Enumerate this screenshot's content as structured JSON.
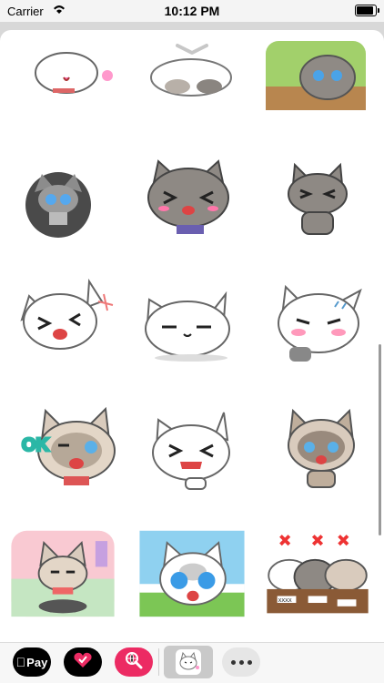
{
  "status_bar": {
    "carrier": "Carrier",
    "time": "10:12 PM"
  },
  "sheet": {
    "grid": {
      "stickers": [
        {
          "name": "sticker-1",
          "desc": "white cat running with heart"
        },
        {
          "name": "sticker-2",
          "desc": "cats playing together"
        },
        {
          "name": "sticker-3",
          "desc": "gray cat on brick wall"
        },
        {
          "name": "sticker-4",
          "desc": "cat on robot vacuum gray"
        },
        {
          "name": "sticker-5",
          "desc": "gray cat laughing"
        },
        {
          "name": "sticker-6",
          "desc": "gray cat excited"
        },
        {
          "name": "sticker-7",
          "desc": "white cat laughing"
        },
        {
          "name": "sticker-8",
          "desc": "white cat lying down"
        },
        {
          "name": "sticker-9",
          "desc": "white cat blushing"
        },
        {
          "name": "sticker-10",
          "desc": "siamese cat OK sign"
        },
        {
          "name": "sticker-11",
          "desc": "white cat giggling"
        },
        {
          "name": "sticker-12",
          "desc": "siamese cat crying"
        },
        {
          "name": "sticker-13",
          "desc": "siamese cat on robot vacuum"
        },
        {
          "name": "sticker-14",
          "desc": "white cat big eyes outdoors"
        },
        {
          "name": "sticker-15",
          "desc": "three cats with X marks"
        }
      ],
      "ok_label": "OK",
      "sign_label": "XXXX"
    }
  },
  "drawer": {
    "apps": [
      {
        "label": "Pay",
        "name": "apple-pay-app"
      },
      {
        "label": "",
        "name": "heart-app"
      },
      {
        "label": "",
        "name": "search-app"
      },
      {
        "label": "",
        "name": "current-sticker-app"
      },
      {
        "label": "",
        "name": "more-apps"
      }
    ]
  },
  "colors": {
    "accent": "#ec2b63",
    "sheet_bg": "#ffffff",
    "drawer_bg": "#f7f7f7"
  }
}
